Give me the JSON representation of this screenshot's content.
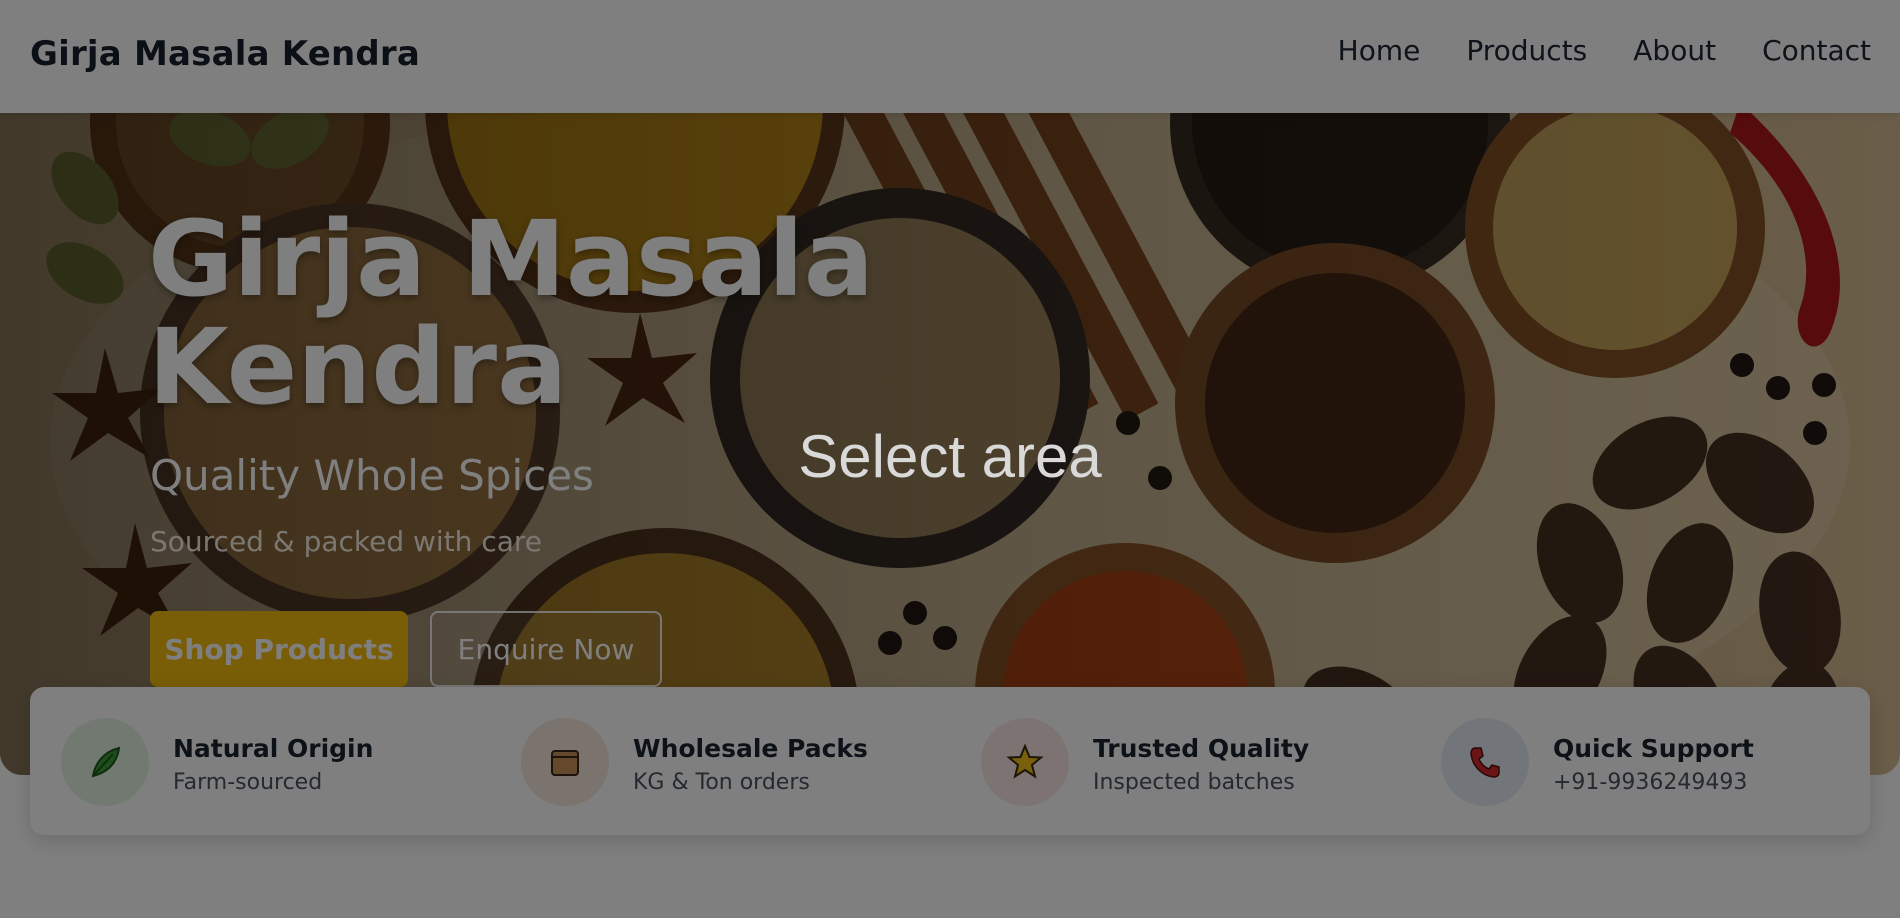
{
  "header": {
    "brand": "Girja Masala Kendra",
    "nav": [
      "Home",
      "Products",
      "About",
      "Contact"
    ]
  },
  "hero": {
    "title_line1": "Girja Masala",
    "title_line2": "Kendra",
    "subtitle": "Quality Whole Spices",
    "tagline": "Sourced & packed with care",
    "primary_button": "Shop Products",
    "secondary_button": "Enquire Now",
    "accent_color": "#f3bd0e"
  },
  "features": [
    {
      "title": "Natural Origin",
      "subtitle": "Farm-sourced",
      "icon": "herb-leaf-icon"
    },
    {
      "title": "Wholesale Packs",
      "subtitle": "KG & Ton orders",
      "icon": "package-box-icon"
    },
    {
      "title": "Trusted Quality",
      "subtitle": "Inspected batches",
      "icon": "star-icon"
    },
    {
      "title": "Quick Support",
      "subtitle": "+91-9936249493",
      "icon": "phone-icon"
    }
  ],
  "overlay": {
    "label": "Select area"
  }
}
